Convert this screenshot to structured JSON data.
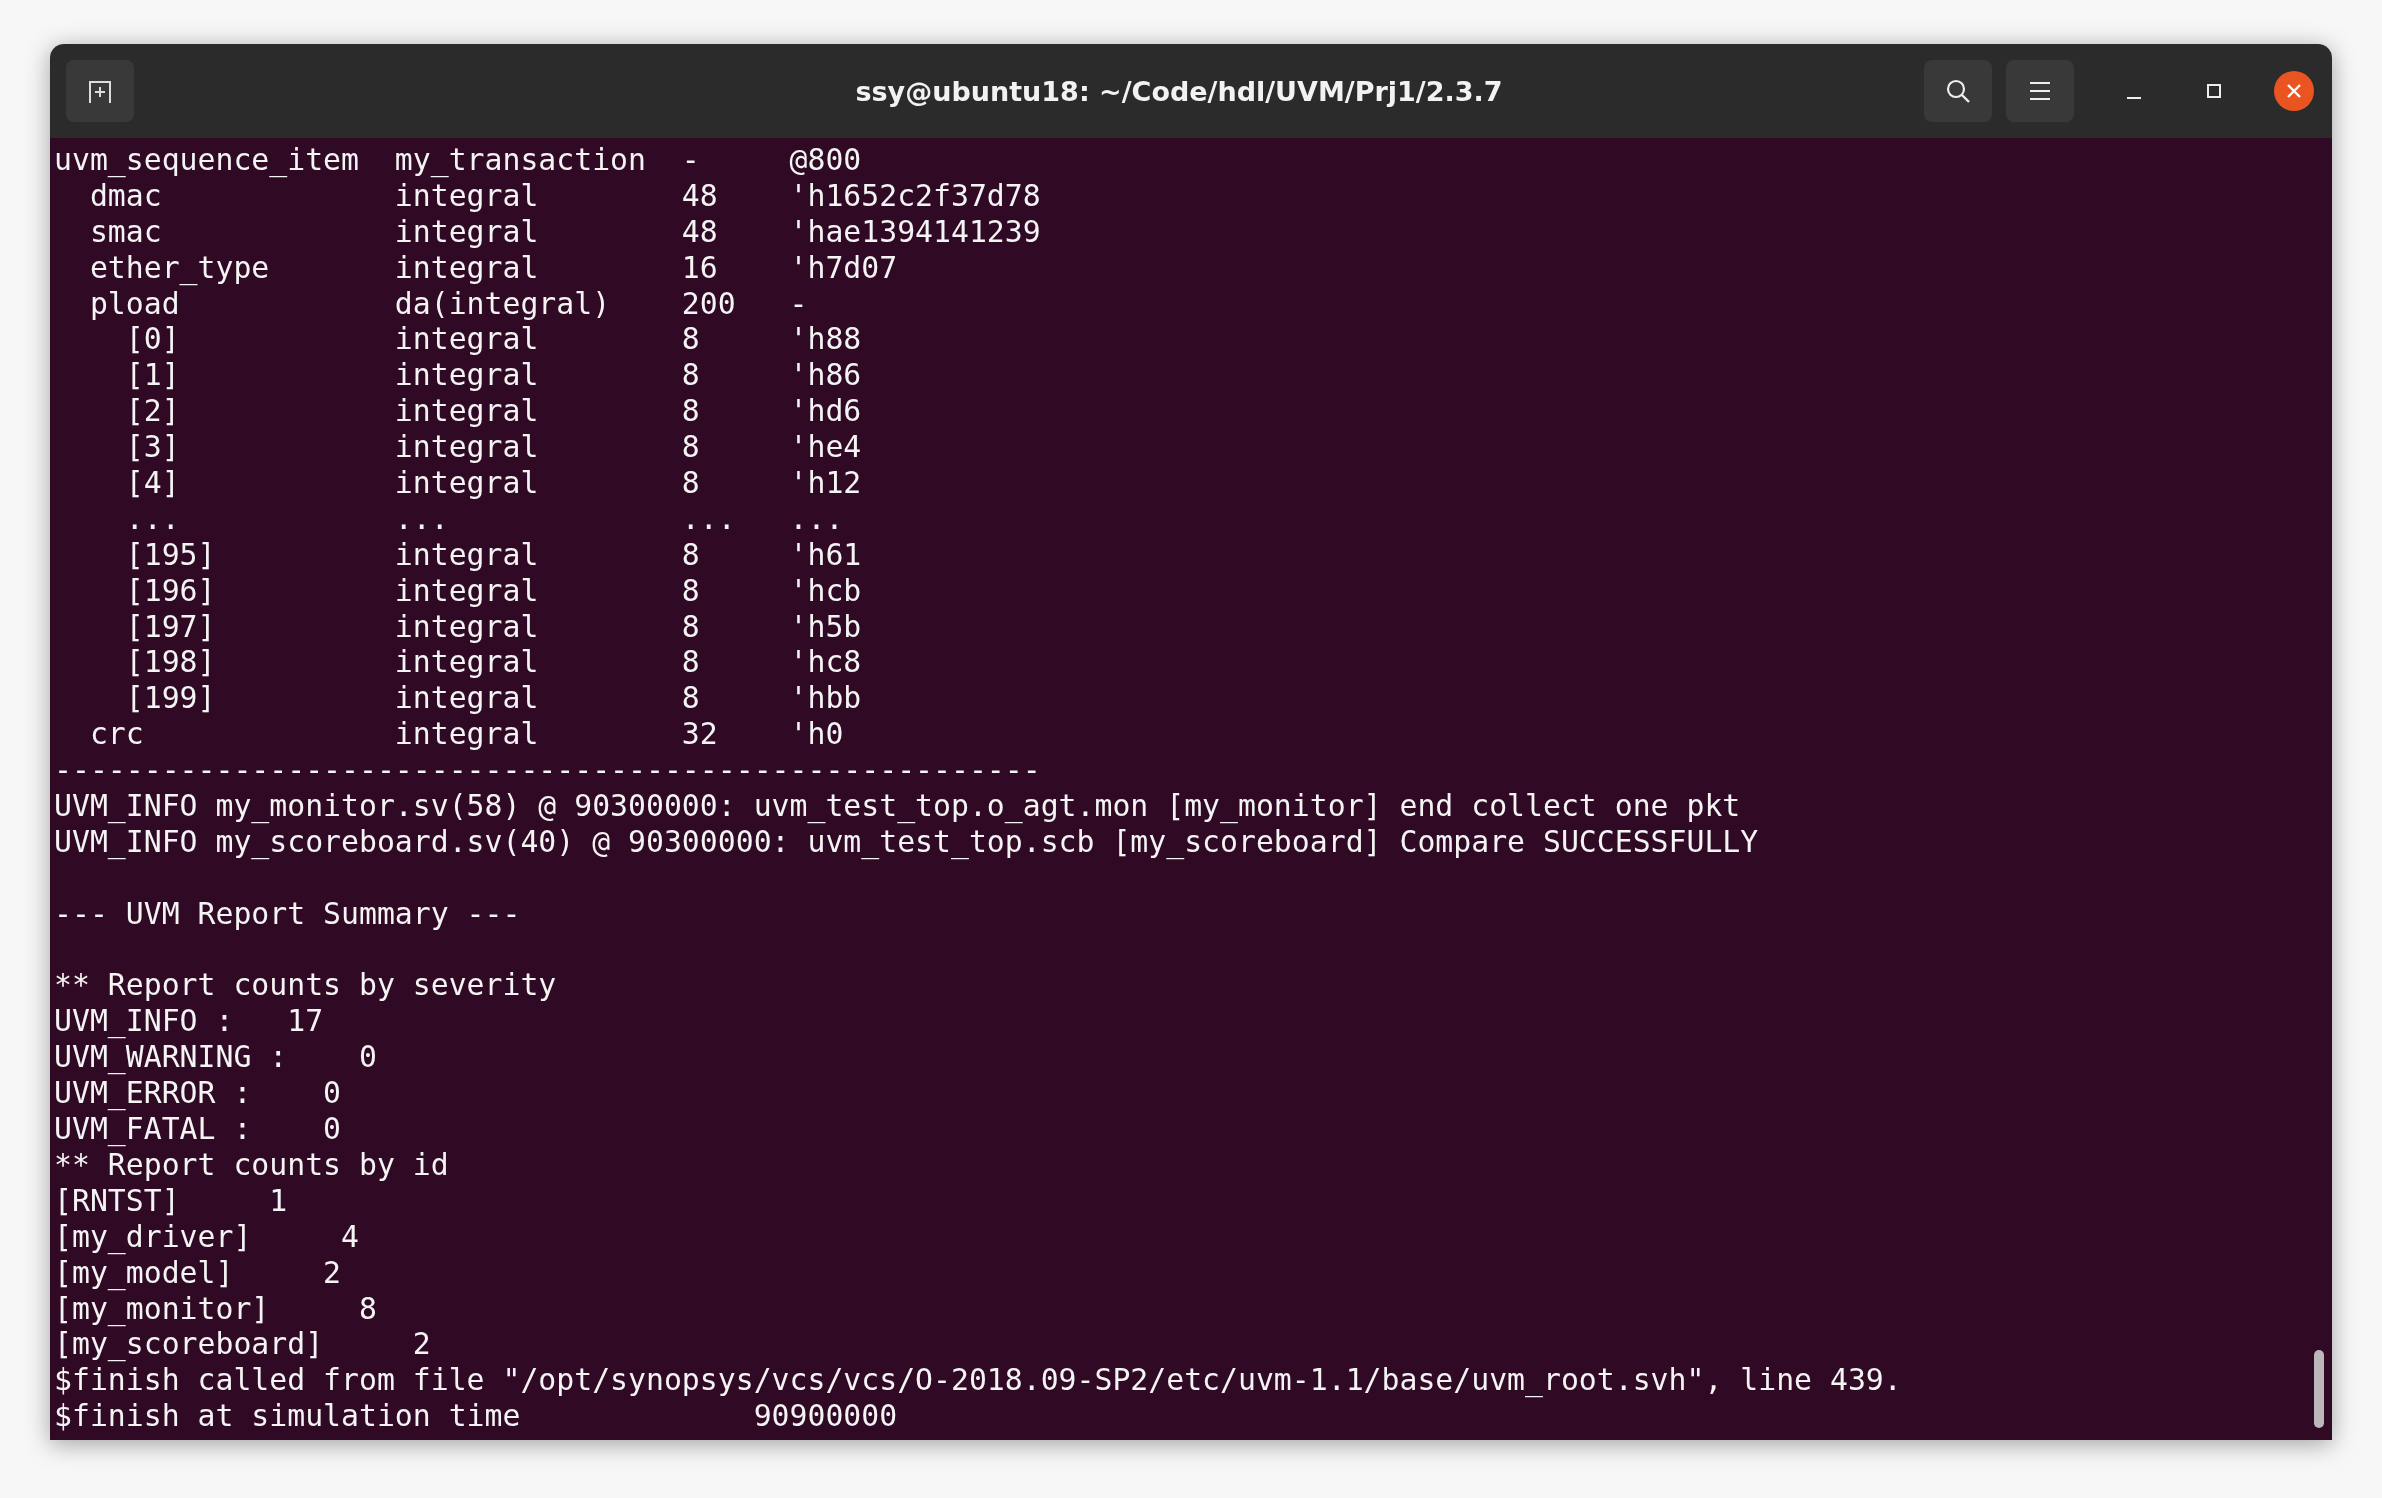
{
  "window": {
    "title": "ssy@ubuntu18: ~/Code/hdl/UVM/Prj1/2.3.7"
  },
  "terminal": {
    "blocks": [
      [
        "uvm_sequence_item  my_transaction  -     @800",
        "  dmac             integral        48    'h1652c2f37d78",
        "  smac             integral        48    'hae1394141239",
        "  ether_type       integral        16    'h7d07",
        "  pload            da(integral)    200   -",
        "    [0]            integral        8     'h88",
        "    [1]            integral        8     'h86",
        "    [2]            integral        8     'hd6",
        "    [3]            integral        8     'he4",
        "    [4]            integral        8     'h12",
        "    ...            ...             ...   ...",
        "    [195]          integral        8     'h61",
        "    [196]          integral        8     'hcb",
        "    [197]          integral        8     'h5b",
        "    [198]          integral        8     'hc8",
        "    [199]          integral        8     'hbb",
        "  crc              integral        32    'h0",
        "-------------------------------------------------------",
        "UVM_INFO my_monitor.sv(58) @ 90300000: uvm_test_top.o_agt.mon [my_monitor] end collect one pkt",
        "UVM_INFO my_scoreboard.sv(40) @ 90300000: uvm_test_top.scb [my_scoreboard] Compare SUCCESSFULLY"
      ],
      [
        "--- UVM Report Summary ---"
      ],
      [
        "** Report counts by severity",
        "UVM_INFO :   17",
        "UVM_WARNING :    0",
        "UVM_ERROR :    0",
        "UVM_FATAL :    0",
        "** Report counts by id",
        "[RNTST]     1",
        "[my_driver]     4",
        "[my_model]     2",
        "[my_monitor]     8",
        "[my_scoreboard]     2",
        "$finish called from file \"/opt/synopsys/vcs/vcs/O-2018.09-SP2/etc/uvm-1.1/base/uvm_root.svh\", line 439.",
        "$finish at simulation time             90900000"
      ]
    ]
  }
}
